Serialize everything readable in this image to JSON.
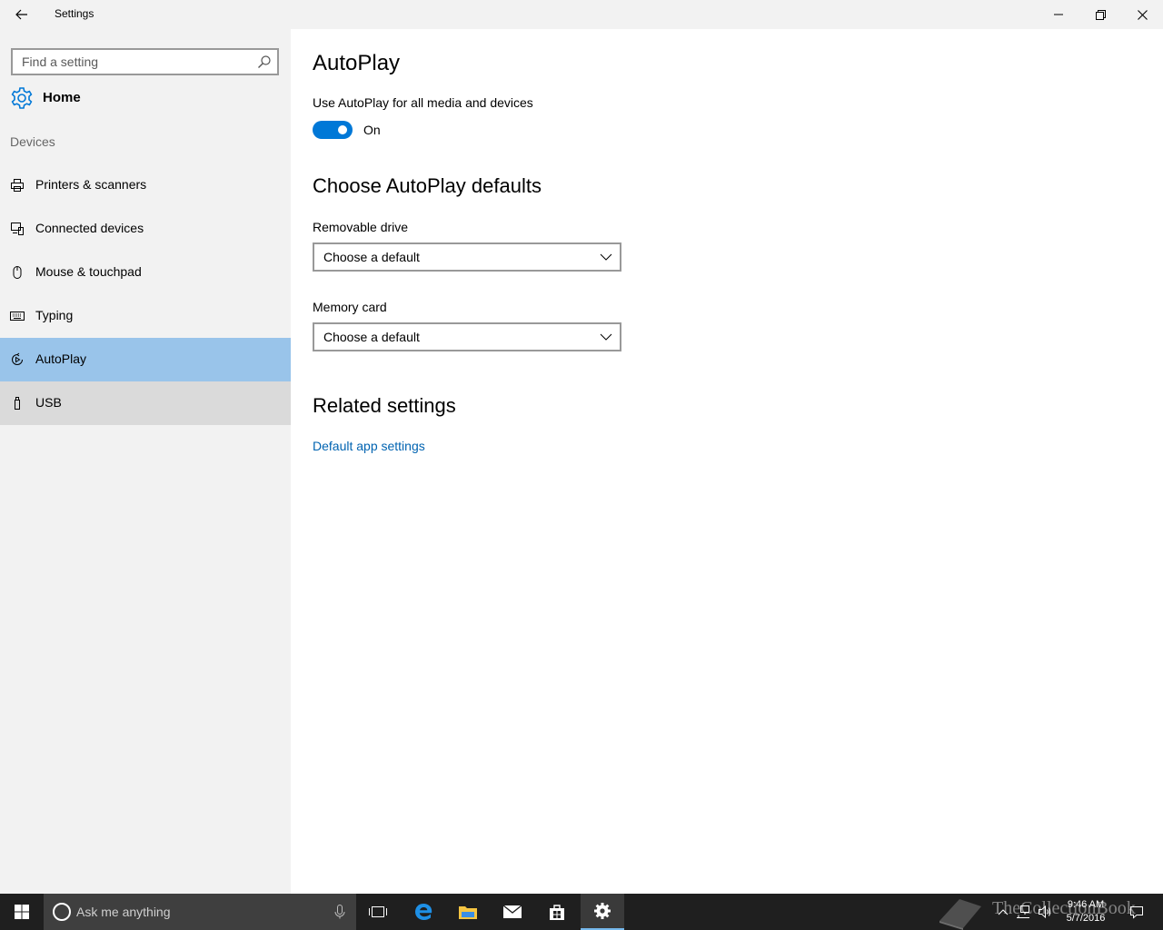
{
  "window": {
    "title": "Settings"
  },
  "sidebar": {
    "search_placeholder": "Find a setting",
    "home_label": "Home",
    "section_label": "Devices",
    "items": [
      {
        "label": "Printers & scanners",
        "icon": "printer-icon"
      },
      {
        "label": "Connected devices",
        "icon": "connected-devices-icon"
      },
      {
        "label": "Mouse & touchpad",
        "icon": "mouse-icon"
      },
      {
        "label": "Typing",
        "icon": "keyboard-icon"
      },
      {
        "label": "AutoPlay",
        "icon": "autoplay-icon",
        "selected": true
      },
      {
        "label": "USB",
        "icon": "usb-icon",
        "hovered": true
      }
    ]
  },
  "main": {
    "title": "AutoPlay",
    "toggle_description": "Use AutoPlay for all media and devices",
    "toggle_state": "On",
    "defaults_heading": "Choose AutoPlay defaults",
    "removable_drive_label": "Removable drive",
    "removable_drive_value": "Choose a default",
    "memory_card_label": "Memory card",
    "memory_card_value": "Choose a default",
    "related_heading": "Related settings",
    "related_link": "Default app settings"
  },
  "taskbar": {
    "search_placeholder": "Ask me anything",
    "time": "9:46 AM",
    "date": "5/7/2016",
    "watermark": "TheCollectionBook"
  },
  "colors": {
    "accent": "#0078d7",
    "selected_bg": "#99c4ea",
    "link": "#0063b1",
    "sidebar_bg": "#f2f2f2",
    "taskbar_bg": "#1f1f1f"
  }
}
